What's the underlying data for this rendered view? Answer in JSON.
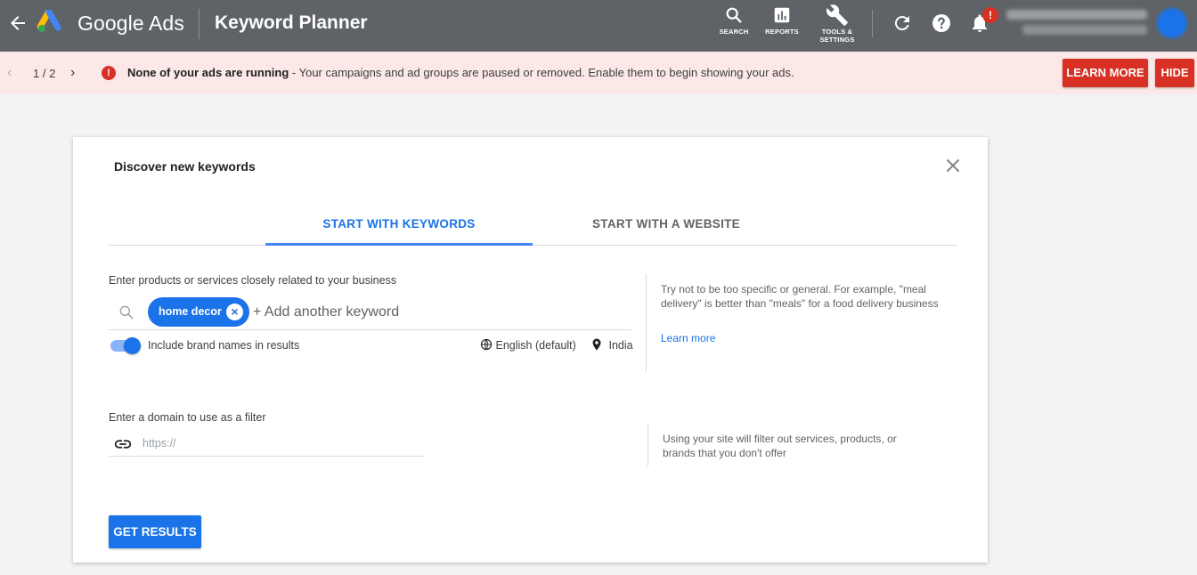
{
  "header": {
    "brand": "Google Ads",
    "page_title": "Keyword Planner",
    "tools": {
      "search": "SEARCH",
      "reports": "REPORTS",
      "settings_line1": "TOOLS &",
      "settings_line2": "SETTINGS"
    },
    "notification_badge": "!"
  },
  "alert": {
    "pager": "1 / 2",
    "title": "None of your ads are running",
    "message": " - Your campaigns and ad groups are paused or removed. Enable them to begin showing your ads.",
    "learn_more": "LEARN MORE",
    "hide": "HIDE"
  },
  "dialog": {
    "title": "Discover new keywords",
    "tabs": [
      {
        "label": "START WITH KEYWORDS",
        "active": true
      },
      {
        "label": "START WITH A WEBSITE",
        "active": false
      }
    ],
    "keywords": {
      "label": "Enter products or services closely related to your business",
      "chip": "home decor",
      "add_placeholder": "+ Add another keyword"
    },
    "brand_toggle": {
      "label": "Include brand names in results",
      "on": true
    },
    "language": "English (default)",
    "location": "India",
    "tip": "Try not to be too specific or general. For example, \"meal delivery\" is better than \"meals\" for a food delivery business",
    "tip_link": "Learn more",
    "domain": {
      "label": "Enter a domain to use as a filter",
      "placeholder": "https://",
      "value": ""
    },
    "domain_tip": "Using your site will filter out services, products, or brands that you don't offer",
    "submit": "GET RESULTS"
  },
  "colors": {
    "topbar": "#5f6368",
    "alert_bg": "#fce8e6",
    "alert_button": "#d93025",
    "primary": "#1a73e8"
  }
}
